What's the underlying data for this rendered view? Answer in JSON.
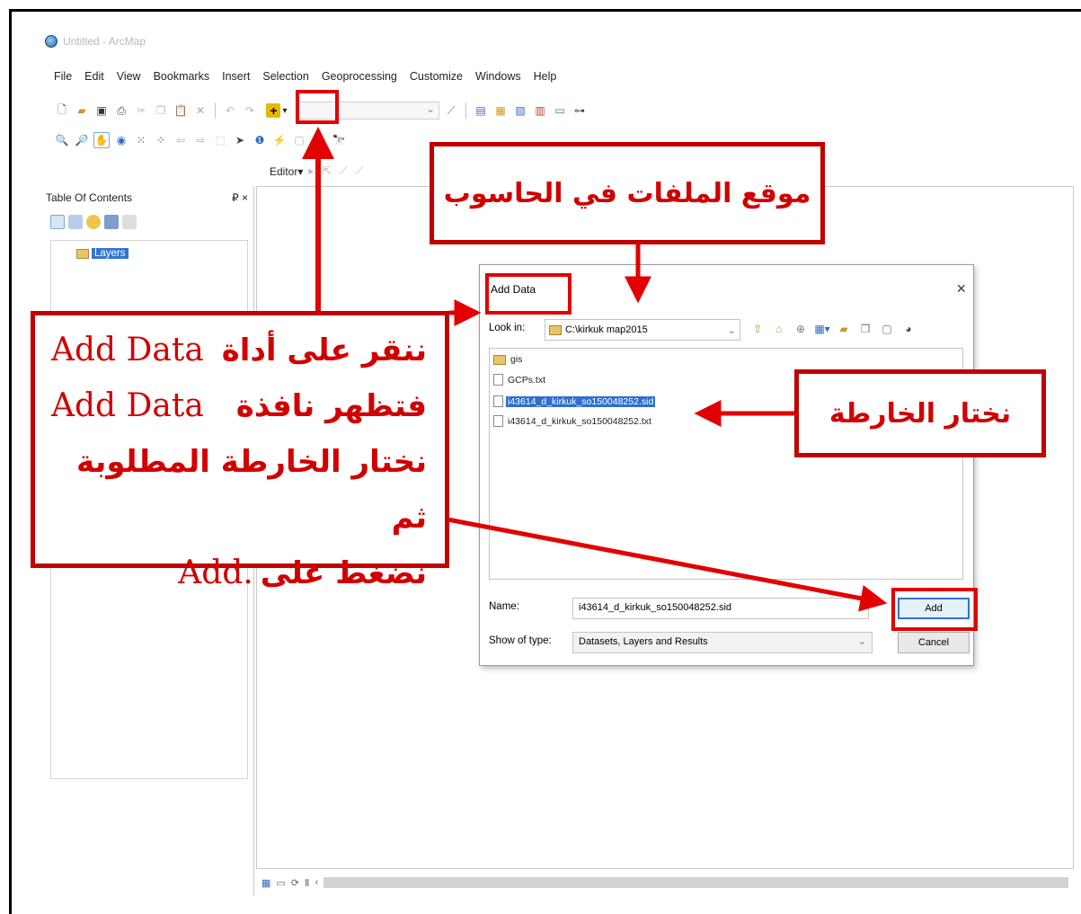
{
  "window": {
    "title": "Untitled - ArcMap"
  },
  "menu": [
    "File",
    "Edit",
    "View",
    "Bookmarks",
    "Insert",
    "Selection",
    "Geoprocessing",
    "Customize",
    "Windows",
    "Help"
  ],
  "toolbar": {
    "editor_label": "Editor▾"
  },
  "toc": {
    "title": "Table Of Contents",
    "pin_close": "₽ ×",
    "root_layer": "Layers"
  },
  "dialog": {
    "title": "Add Data",
    "close": "×",
    "look_in_label": "Look in:",
    "look_in_value": "C:\\kirkuk map2015",
    "files": [
      {
        "name": "gis",
        "type": "folder",
        "selected": false
      },
      {
        "name": "GCPs.txt",
        "type": "file",
        "selected": false
      },
      {
        "name": "i43614_d_kirkuk_so150048252.sid",
        "type": "raster",
        "selected": true
      },
      {
        "name": "i43614_d_kirkuk_so150048252.txt",
        "type": "file",
        "selected": false
      }
    ],
    "name_label": "Name:",
    "name_value": "i43614_d_kirkuk_so150048252.sid",
    "type_label": "Show of type:",
    "type_value": "Datasets, Layers and Results",
    "add_button": "Add",
    "cancel_button": "Cancel"
  },
  "annotations": {
    "top_callout": "موقع الملفات في الحاسوب",
    "right_callout": "نختار الخارطة",
    "left_callout": {
      "line1_arabic": "ننقر على أداة",
      "line1_latin": "Add Data",
      "line2_arabic": "فتظهر نافذة",
      "line2_latin": "Add Data",
      "line3": "نختار الخارطة المطلوبة ثم",
      "line4_arabic": "نضغط على",
      "line4_latin": "Add."
    },
    "color": "#d10000"
  }
}
